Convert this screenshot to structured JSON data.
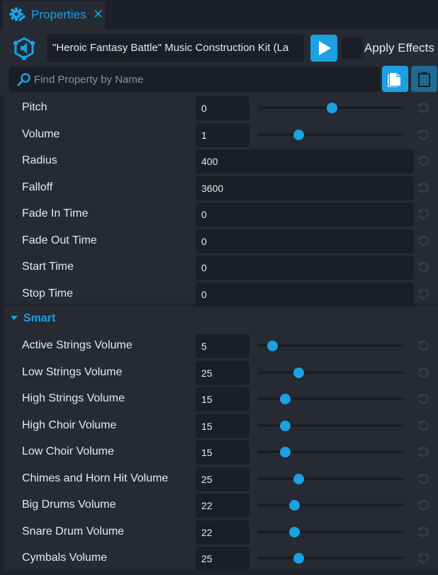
{
  "tab": {
    "title": "Properties",
    "icon": "gear-wrench-icon",
    "close_icon": "close-icon"
  },
  "header": {
    "object_icon": "audio-hexagon-icon",
    "object_name": "\"Heroic Fantasy Battle\" Music Construction Kit (La",
    "play_icon": "play-icon",
    "apply_effects_label": "Apply Effects",
    "apply_effects_checked": false
  },
  "search": {
    "placeholder": "Find Property by Name",
    "value": "",
    "icon": "search-icon",
    "copy_icon": "copy-icon",
    "paste_icon": "clipboard-icon"
  },
  "colors": {
    "accent": "#1ba1e2",
    "panel_bg": "#262a33",
    "field_bg": "#1b1e25",
    "text": "#e6e8ec"
  },
  "audio_properties": [
    {
      "label": "Pitch",
      "value": "0",
      "slider": true,
      "slider_fraction": 0.5
    },
    {
      "label": "Volume",
      "value": "1",
      "slider": true,
      "slider_fraction": 0.275
    },
    {
      "label": "Radius",
      "value": "400",
      "slider": false
    },
    {
      "label": "Falloff",
      "value": "3600",
      "slider": false
    },
    {
      "label": "Fade In Time",
      "value": "0",
      "slider": false
    },
    {
      "label": "Fade Out Time",
      "value": "0",
      "slider": false
    },
    {
      "label": "Start Time",
      "value": "0",
      "slider": false
    },
    {
      "label": "Stop Time",
      "value": "0",
      "slider": false
    }
  ],
  "smart_section": {
    "title": "Smart",
    "expanded": true,
    "properties": [
      {
        "label": "Active Strings Volume",
        "value": "5",
        "slider_fraction": 0.095
      },
      {
        "label": "Low Strings Volume",
        "value": "25",
        "slider_fraction": 0.275
      },
      {
        "label": "High Strings Volume",
        "value": "15",
        "slider_fraction": 0.185
      },
      {
        "label": "High Choir Volume",
        "value": "15",
        "slider_fraction": 0.185
      },
      {
        "label": "Low Choir Volume",
        "value": "15",
        "slider_fraction": 0.185
      },
      {
        "label": "Chimes and Horn Hit Volume",
        "value": "25",
        "slider_fraction": 0.275
      },
      {
        "label": "Big Drums Volume",
        "value": "22",
        "slider_fraction": 0.245
      },
      {
        "label": "Snare Drum Volume",
        "value": "22",
        "slider_fraction": 0.245
      },
      {
        "label": "Cymbals Volume",
        "value": "25",
        "slider_fraction": 0.275
      }
    ]
  }
}
